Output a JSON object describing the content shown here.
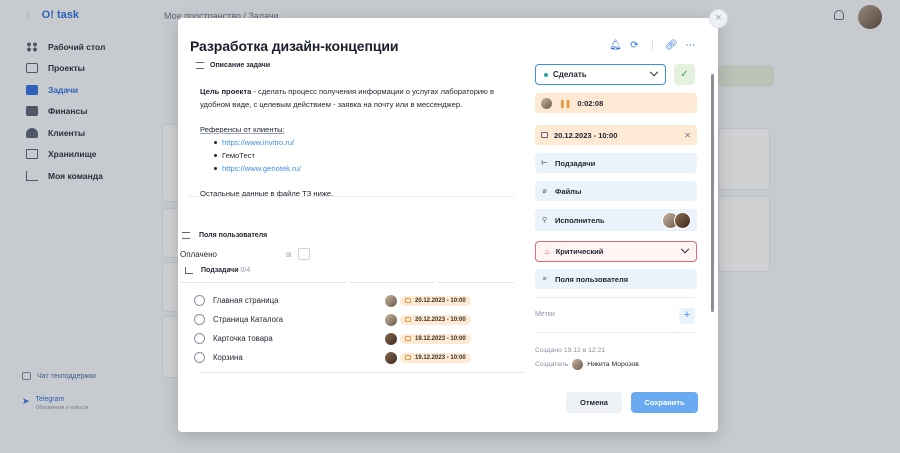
{
  "app": {
    "brand": "O! task",
    "back": "‹",
    "breadcrumb": "Мое пространство  /  Задачи"
  },
  "sidebar": {
    "items": [
      {
        "label": "Рабочий стол",
        "icon": "dashboard-icon"
      },
      {
        "label": "Проекты",
        "icon": "briefcase-icon"
      },
      {
        "label": "Задачи",
        "icon": "tasks-icon",
        "active": true
      },
      {
        "label": "Финансы",
        "icon": "wallet-icon"
      },
      {
        "label": "Клиенты",
        "icon": "people-icon"
      },
      {
        "label": "Хранилище",
        "icon": "storage-icon"
      },
      {
        "label": "Моя команда",
        "icon": "team-icon"
      }
    ],
    "support": "Чат техподдержки",
    "telegram": {
      "title": "Telegram",
      "subtitle": "Обновления и новости"
    }
  },
  "modal": {
    "title": "Разработка дизайн-концепции",
    "description_section": "Описание задачи",
    "description": {
      "goal_label": "Цель проекта",
      "goal_text": " - сделать процесс получения информации о услугах лабораторию в удобном виде, с целевым действием - заявка на почту или в мессенджер.",
      "refs_label": "Референсы от клиенты:",
      "refs": [
        "https://www.invitro.ru/",
        "ГемоТест",
        "https://www.genotek.ru/"
      ],
      "rest": "Остальные данные в файле ТЗ ниже."
    },
    "custom_fields_label": "Поля пользователя",
    "paid_label": "Оплачено",
    "subtasks_label": "Подзадачи",
    "subtasks_count": "0/4",
    "subtasks": [
      {
        "name": "Главная страница",
        "date": "20.12.2023 - 10:00"
      },
      {
        "name": "Страница Каталога",
        "date": "20.12.2023 - 10:00"
      },
      {
        "name": "Карточка товара",
        "date": "19.12.2023 - 10:00"
      },
      {
        "name": "Корзина",
        "date": "19.12.2023 - 10:00"
      }
    ],
    "status": "Сделать",
    "timer": "0:02:08",
    "deadline": "20.12.2023 - 10:00",
    "subtasks_button": "Подзадачи",
    "files_button": "Файлы",
    "executor_button": "Исполнитель",
    "priority": "Критический",
    "custom_fields_button": "Поля пользователя",
    "tags_label": "Метки",
    "created": "Создано 19.12 в 12:21",
    "creator_label": "Создатель",
    "creator_name": "Никита Морозов",
    "cancel": "Отмена",
    "save": "Сохранить",
    "close": "×"
  },
  "colors": {
    "accent": "#2d6fe0",
    "link": "#3c8de6",
    "deadline_bg": "#fde9d4",
    "priority_border": "#e26b73",
    "save_bg": "#6aaaf0"
  }
}
